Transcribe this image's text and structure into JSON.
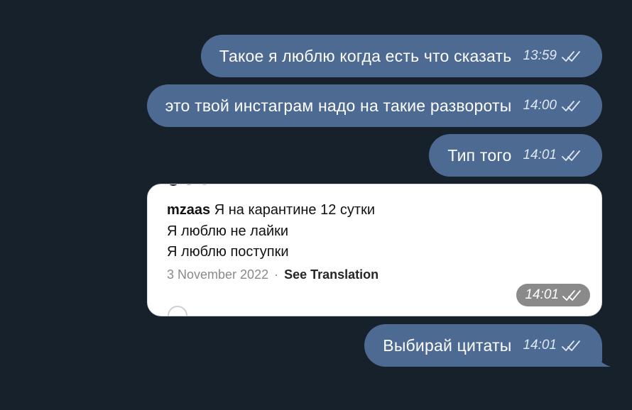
{
  "messages": [
    {
      "text": "Такое я люблю когда есть что сказать",
      "time": "13:59"
    },
    {
      "text": "это твой инстаграм надо на такие развороты",
      "time": "14:00"
    },
    {
      "text": "Тип того",
      "time": "14:01"
    },
    {
      "text": "Выбирай цитаты",
      "time": "14:01"
    }
  ],
  "photo": {
    "comment": {
      "username": "mzaas",
      "line1": "Я на карантине 12 сутки",
      "line2": "Я люблю не лайки",
      "line3": "Я люблю поступки"
    },
    "date": "3 November 2022",
    "separator": "·",
    "see_translation": "See Translation",
    "time": "14:01"
  },
  "colors": {
    "background": "#17212b",
    "outgoing_bubble": "#4d6a93",
    "photo_time_badge": "#8a8a8a"
  },
  "icons": {
    "read_status": "double-check-icon"
  }
}
